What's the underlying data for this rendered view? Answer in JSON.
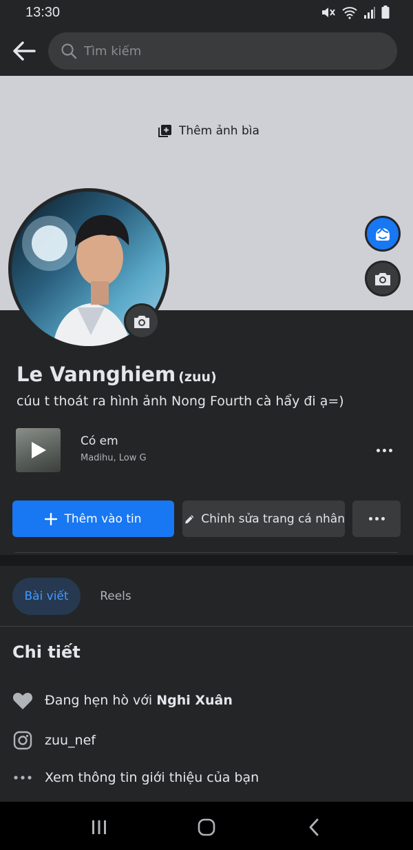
{
  "status_bar": {
    "time": "13:30"
  },
  "header": {
    "search_placeholder": "Tìm kiếm"
  },
  "cover": {
    "add_cover_label": "Thêm ảnh bìa"
  },
  "profile": {
    "name": "Le Vannghiem",
    "nickname": "(zuu)",
    "bio": "cúu t thoát ra hình ảnh Nong Fourth cà hẩy đi ạ=)"
  },
  "music": {
    "title": "Có em",
    "artist": "Madihu, Low G"
  },
  "actions": {
    "add_story_label": "Thêm vào tin",
    "edit_profile_label": "Chỉnh sửa trang cá nhân"
  },
  "tabs": [
    {
      "label": "Bài viết",
      "active": true
    },
    {
      "label": "Reels",
      "active": false
    }
  ],
  "details": {
    "title": "Chi tiết",
    "relationship_prefix": "Đang hẹn hò với",
    "relationship_partner": "Nghi Xuân",
    "instagram": "zuu_nef",
    "see_about": "Xem thông tin giới thiệu của bạn"
  },
  "colors": {
    "accent": "#1877f2",
    "background": "#242526",
    "cover": "#cfd0d6",
    "surface": "#3a3b3c"
  }
}
